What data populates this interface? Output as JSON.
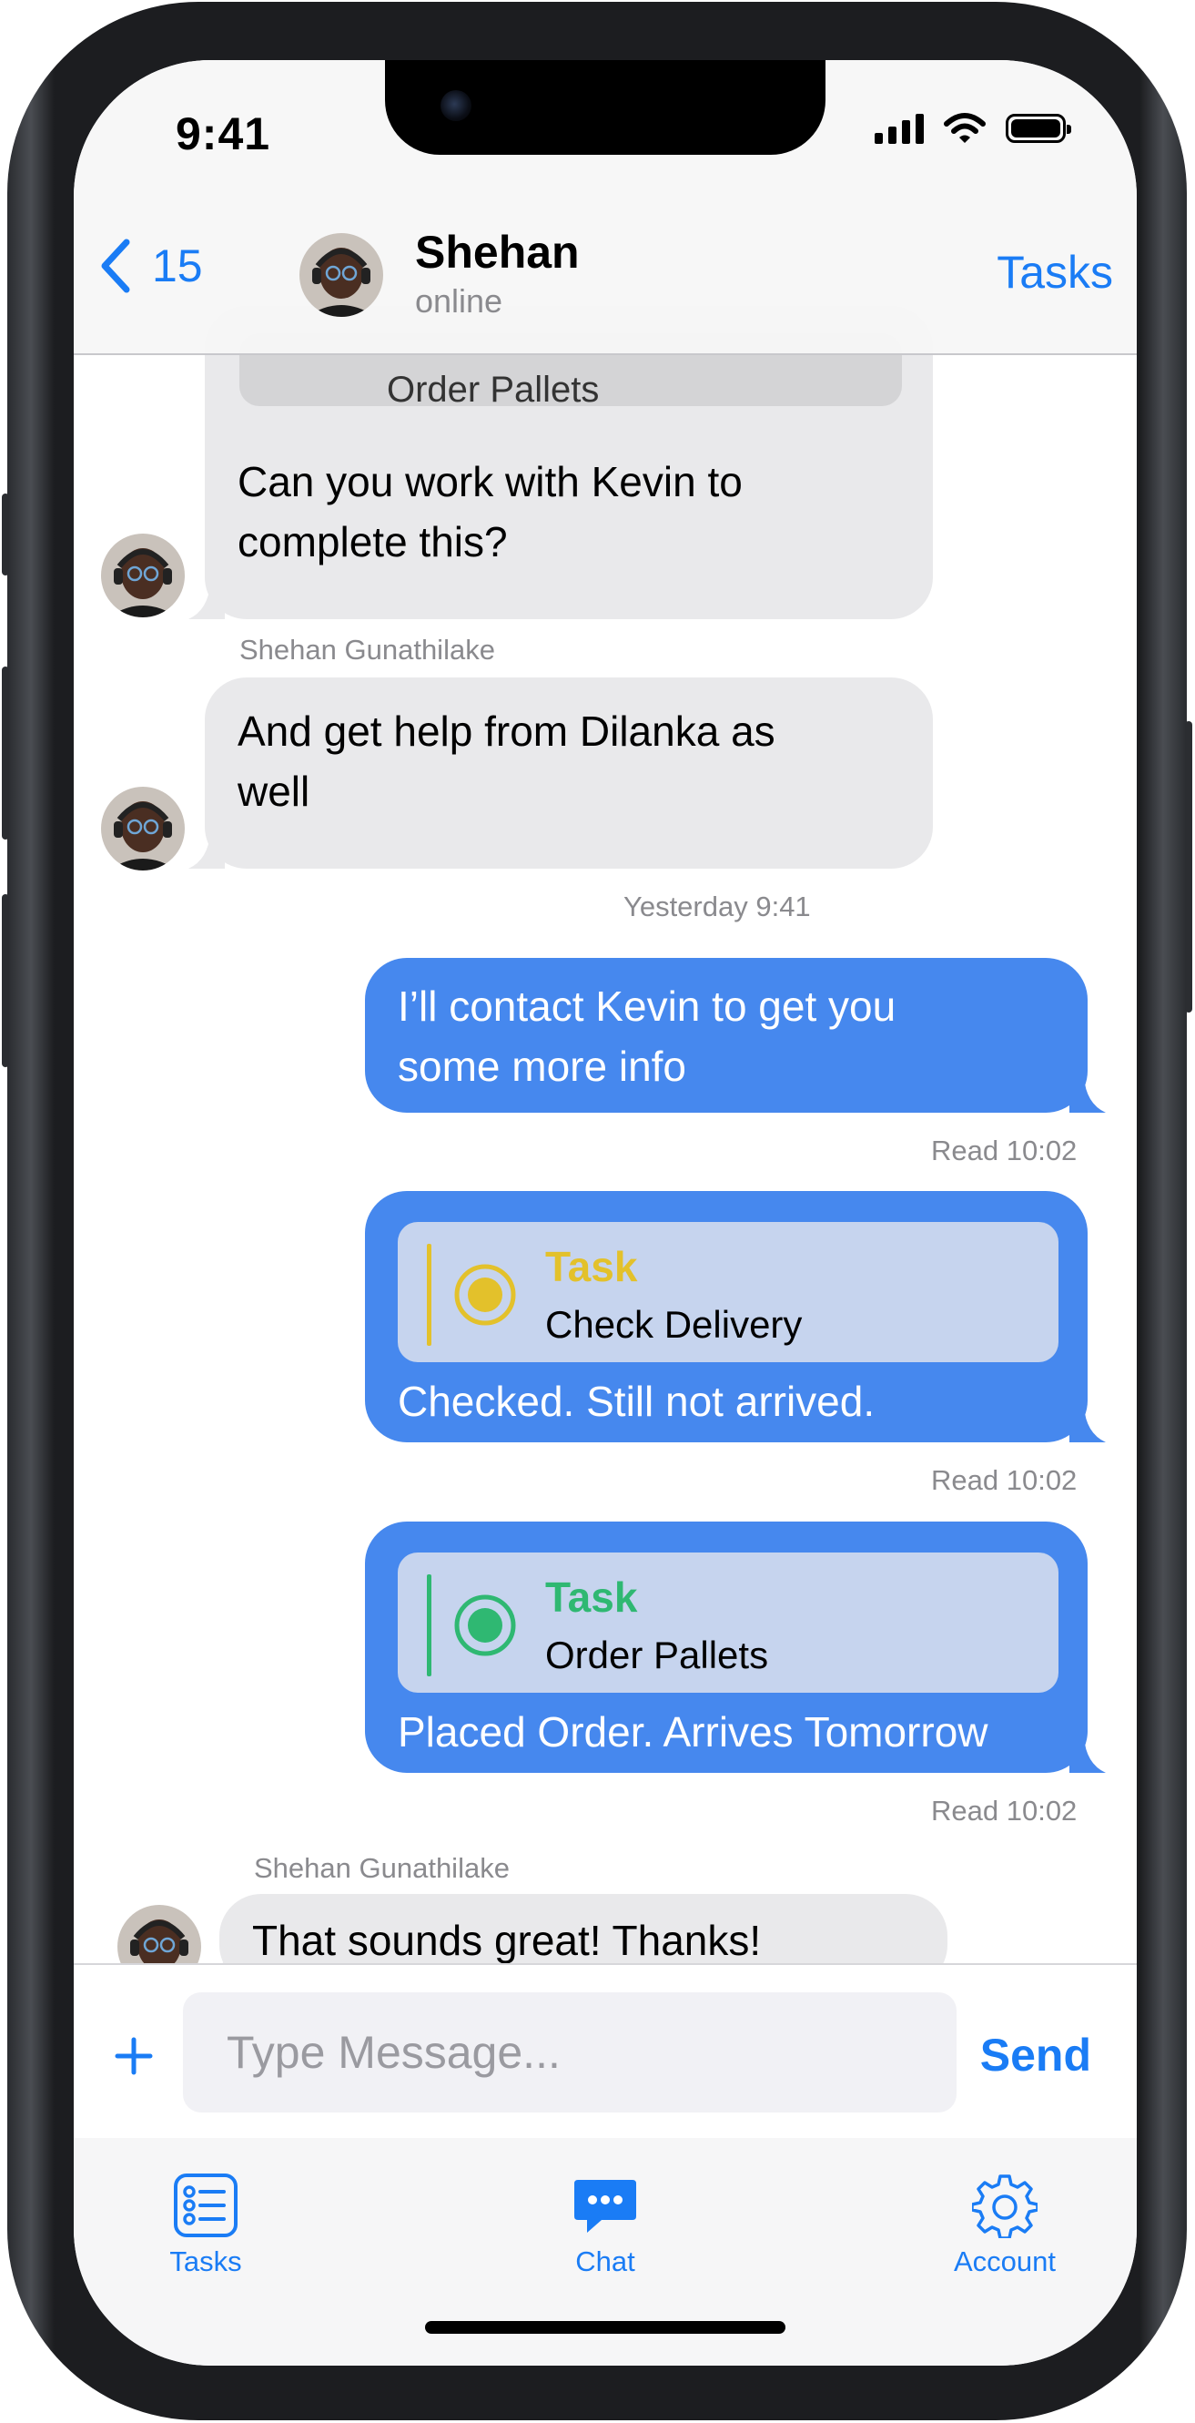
{
  "status_bar": {
    "time": "9:41"
  },
  "nav": {
    "back_count": "15",
    "contact_name": "Shehan",
    "contact_status": "online",
    "tasks_link": "Tasks"
  },
  "messages": [
    {
      "quote_text": "Order Pallets",
      "text_line1": "Can you work with Kevin to",
      "text_line2": "complete this?"
    },
    {
      "sender": "Shehan Gunathilake",
      "text_line1": "And get help from Dilanka as",
      "text_line2": "well"
    },
    {
      "timestamp": "Yesterday 9:41"
    },
    {
      "text_line1": "I’ll contact Kevin to get you",
      "text_line2": "some more info",
      "receipt": "Read 10:02"
    },
    {
      "task_label": "Task",
      "task_name": "Check Delivery",
      "text": "Checked. Still not arrived.",
      "receipt": "Read 10:02",
      "task_color": "#e3c12b"
    },
    {
      "task_label": "Task",
      "task_name": "Order Pallets",
      "text": "Placed Order. Arrives Tomorrow",
      "receipt": "Read 10:02",
      "task_color": "#2fb872"
    },
    {
      "sender": "Shehan Gunathilake",
      "text": "That sounds great! Thanks!"
    }
  ],
  "composer": {
    "placeholder": "Type Message...",
    "send_label": "Send"
  },
  "tabs": [
    {
      "label": "Tasks",
      "icon": "list-icon"
    },
    {
      "label": "Chat",
      "icon": "chat-bubble-icon"
    },
    {
      "label": "Account",
      "icon": "gear-icon"
    }
  ],
  "colors": {
    "accent": "#1a7cf5",
    "outgoing_bubble": "#4688ee",
    "incoming_bubble": "#e9e9eb"
  }
}
